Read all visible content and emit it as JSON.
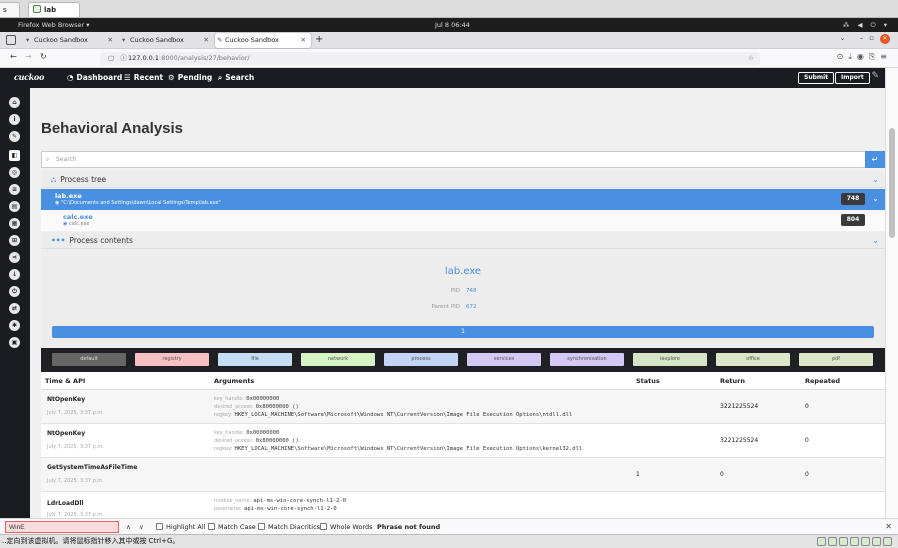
{
  "host": {
    "tabs": [
      {
        "label": "s"
      },
      {
        "label": "lab",
        "active": true
      }
    ]
  },
  "topPanel": {
    "app_label": "Firefox Web Browser ▾",
    "clock": "Jul 8  06:44",
    "tray": "⁂ ◀ ⏻ ▾"
  },
  "firefox": {
    "tabs": [
      {
        "label": "Cuckoo Sandbox"
      },
      {
        "label": "Cuckoo Sandbox"
      },
      {
        "label": "Cuckoo Sandbox",
        "active": true
      }
    ],
    "new_tab": "+",
    "url_host": "127.0.0.1",
    "url_path": ":8000/analysis/27/behavior/"
  },
  "cuckoo": {
    "logo": "cuckoo",
    "nav": [
      {
        "label": "Dashboard",
        "icon": "dashboard-icon"
      },
      {
        "label": "Recent",
        "icon": "list-icon"
      },
      {
        "label": "Pending",
        "icon": "gears-icon"
      },
      {
        "label": "Search",
        "icon": "search-icon"
      }
    ],
    "submit_label": "Submit",
    "import_label": "Import"
  },
  "page": {
    "title": "Behavioral Analysis",
    "search_placeholder": "Search"
  },
  "process_tree": {
    "heading": "Process tree",
    "processes": [
      {
        "name": "lab.exe",
        "cmd": "\"C:\\Documents and Settings\\dawn\\Local Settings\\Temp\\lab.exe\"",
        "pid": "748",
        "selected": true
      },
      {
        "name": "calc.exe",
        "cmd": "calc.exe",
        "pid": "804",
        "selected": false
      }
    ]
  },
  "process_contents": {
    "heading": "Process contents",
    "name": "lab.exe",
    "pid_label": "PID",
    "pid": "748",
    "ppid_label": "Parent PID",
    "ppid": "672",
    "page": "1"
  },
  "categories": [
    {
      "label": "default",
      "color": "#666666",
      "text": "#dddddd"
    },
    {
      "label": "registry",
      "color": "#f9c0c4",
      "text": "#555555"
    },
    {
      "label": "file",
      "color": "#c4dcf4",
      "text": "#555555"
    },
    {
      "label": "network",
      "color": "#d7f5c4",
      "text": "#555555"
    },
    {
      "label": "process",
      "color": "#c4d4f4",
      "text": "#555555"
    },
    {
      "label": "services",
      "color": "#d4c8f4",
      "text": "#555555"
    },
    {
      "label": "synchronisation",
      "color": "#d6c8f4",
      "text": "#555555"
    },
    {
      "label": "iexplore",
      "color": "#d6e4c8",
      "text": "#555555"
    },
    {
      "label": "office",
      "color": "#dce6c8",
      "text": "#555555"
    },
    {
      "label": "pdf",
      "color": "#dce6c8",
      "text": "#555555"
    }
  ],
  "table": {
    "headers": [
      "Time & API",
      "Arguments",
      "Status",
      "Return",
      "Repeated"
    ],
    "rows": [
      {
        "api": "NtOpenKey",
        "time": "July 7, 2025, 3:37 p.m.",
        "args": [
          {
            "k": "key_handle:",
            "v": "0x00000000"
          },
          {
            "k": "desired_access:",
            "v": "0x80000000 ()"
          },
          {
            "k": "regkey:",
            "v": "HKEY_LOCAL_MACHINE\\Software\\Microsoft\\Windows NT\\CurrentVersion\\Image File Execution Options\\ntdll.dll"
          }
        ],
        "status": "",
        "ret": "3221225524",
        "repeated": "0"
      },
      {
        "api": "NtOpenKey",
        "time": "July 7, 2025, 3:37 p.m.",
        "args": [
          {
            "k": "key_handle:",
            "v": "0x00000000"
          },
          {
            "k": "desired_access:",
            "v": "0x80000000 ()"
          },
          {
            "k": "regkey:",
            "v": "HKEY_LOCAL_MACHINE\\Software\\Microsoft\\Windows NT\\CurrentVersion\\Image File Execution Options\\kernel32.dll"
          }
        ],
        "status": "",
        "ret": "3221225524",
        "repeated": "0"
      },
      {
        "api": "GetSystemTimeAsFileTime",
        "time": "July 7, 2025, 3:37 p.m.",
        "args": [],
        "status": "1",
        "ret": "0",
        "repeated": "0"
      },
      {
        "api": "LdrLoadDll",
        "time": "July 7, 2025, 3:37 p.m.",
        "args": [
          {
            "k": "module_name:",
            "v": "api-ms-win-core-synch-l1-2-0"
          },
          {
            "k": "basename:",
            "v": "api-ms-win-core-synch-l1-2-0"
          }
        ],
        "status": "",
        "ret": "",
        "repeated": ""
      }
    ]
  },
  "findbar": {
    "value": "WinE",
    "options": [
      "Highlight All",
      "Match Case",
      "Match Diacritics",
      "Whole Words"
    ],
    "status": "Phrase not found"
  },
  "vm_status": "..定向到该虚拟机。请将鼠标指针移入其中或按 Ctrl+G。"
}
